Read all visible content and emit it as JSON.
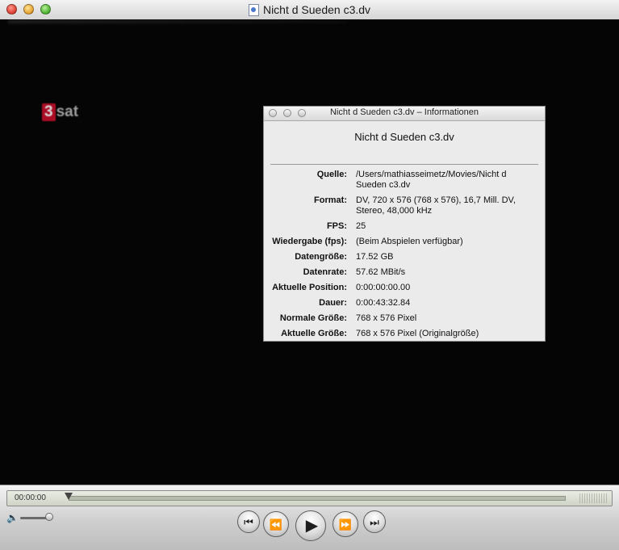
{
  "window": {
    "title": "Nicht d Sueden c3.dv"
  },
  "video": {
    "logo_number": "3",
    "logo_text": "sat"
  },
  "info_panel": {
    "title": "Nicht d Sueden c3.dv – Informationen",
    "heading": "Nicht d Sueden c3.dv",
    "rows": [
      {
        "label": "Quelle:",
        "value": "/Users/mathiasseimetz/Movies/Nicht d Sueden c3.dv"
      },
      {
        "label": "Format:",
        "value": "DV, 720 x 576 (768 x 576), 16,7 Mill. DV, Stereo, 48,000 kHz"
      },
      {
        "label": "FPS:",
        "value": "25"
      },
      {
        "label": "Wiedergabe (fps):",
        "value": "(Beim Abspielen verfügbar)"
      },
      {
        "label": "Datengröße:",
        "value": "17.52 GB"
      },
      {
        "label": "Datenrate:",
        "value": "57.62 MBit/s"
      },
      {
        "label": "Aktuelle Position:",
        "value": "0:00:00:00.00"
      },
      {
        "label": "Dauer:",
        "value": "0:00:43:32.84"
      },
      {
        "label": "Normale Größe:",
        "value": "768 x 576 Pixel"
      },
      {
        "label": "Aktuelle Größe:",
        "value": "768 x 576 Pixel (Originalgröße)"
      }
    ]
  },
  "controls": {
    "timecode": "00:00:00",
    "playback_progress": 0.0,
    "volume_level": 0.9,
    "icons": {
      "start": "skip-to-start-icon",
      "rewind": "rewind-icon",
      "play": "play-icon",
      "fast_forward": "fast-forward-icon",
      "end": "skip-to-end-icon",
      "volume": "speaker-icon"
    }
  },
  "colors": {
    "logo_red": "#c8102a",
    "video_background": "#050505"
  }
}
